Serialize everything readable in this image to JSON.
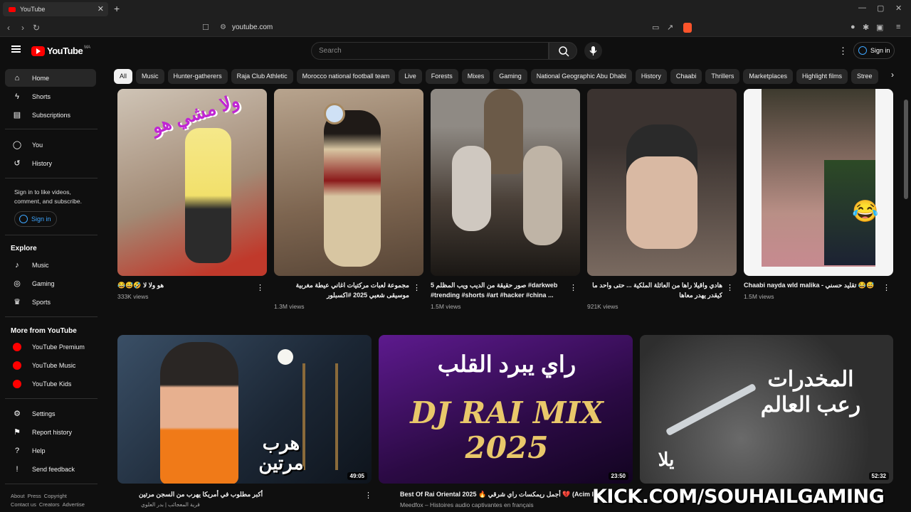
{
  "browser": {
    "tab_title": "YouTube",
    "url": "youtube.com"
  },
  "header": {
    "logo_text": "YouTube",
    "region": "MA",
    "search_placeholder": "Search",
    "signin_label": "Sign in"
  },
  "sidebar": {
    "main": [
      {
        "label": "Home",
        "icon": "home-icon",
        "active": true
      },
      {
        "label": "Shorts",
        "icon": "shorts-icon"
      },
      {
        "label": "Subscriptions",
        "icon": "subscriptions-icon"
      }
    ],
    "you": [
      {
        "label": "You",
        "icon": "user-icon"
      },
      {
        "label": "History",
        "icon": "history-icon"
      }
    ],
    "signin_note": "Sign in to like videos, comment, and subscribe.",
    "signin_label": "Sign in",
    "explore_heading": "Explore",
    "explore": [
      {
        "label": "Music",
        "icon": "music-icon"
      },
      {
        "label": "Gaming",
        "icon": "gaming-icon"
      },
      {
        "label": "Sports",
        "icon": "trophy-icon"
      }
    ],
    "more_heading": "More from YouTube",
    "more": [
      {
        "label": "YouTube Premium",
        "icon": "youtube-premium-icon"
      },
      {
        "label": "YouTube Music",
        "icon": "youtube-music-icon"
      },
      {
        "label": "YouTube Kids",
        "icon": "youtube-kids-icon"
      }
    ],
    "settings": [
      {
        "label": "Settings",
        "icon": "gear-icon"
      },
      {
        "label": "Report history",
        "icon": "flag-icon"
      },
      {
        "label": "Help",
        "icon": "help-icon"
      },
      {
        "label": "Send feedback",
        "icon": "feedback-icon"
      }
    ],
    "footer_row1": [
      "About",
      "Press",
      "Copyright"
    ],
    "footer_row2": [
      "Contact us",
      "Creators",
      "Advertise"
    ]
  },
  "chips": [
    "All",
    "Music",
    "Hunter-gatherers",
    "Raja Club Athletic",
    "Morocco national football team",
    "Live",
    "Forests",
    "Mixes",
    "Gaming",
    "National Geographic Abu Dhabi",
    "History",
    "Chaabi",
    "Thrillers",
    "Marketplaces",
    "Highlight films",
    "Stree"
  ],
  "shorts": [
    {
      "title": "😂😅🤣 هو ولا لا",
      "views": "333K views",
      "thumb_text": "ولا مشي هو",
      "bg": "#b8a58f"
    },
    {
      "title": "مجموعة لعبات مركتيات اغاني عيطة مغربية موسيقى شعبي 2025 #اكسبلور",
      "views": "1.3M views",
      "bg": "#8a7663"
    },
    {
      "title": "5 صور حقيقة من الديب ويب المظلم #darkweb #trending #shorts #art #hacker #china ...",
      "views": "1.5M views",
      "bg": "#5a534a"
    },
    {
      "title": "هادي واقيلا راها من العائلة الملكية ... حتى واحد ما كيقدر يهدر معاها",
      "views": "921K views",
      "bg": "#6e6158"
    },
    {
      "title": "Chaabi nayda wld malika - تقليد حسني 😂😅",
      "views": "1.5M views",
      "bg": "#6a5a4c"
    }
  ],
  "videos": [
    {
      "title": "أكبر مطلوب في أمريكا يهرب من السجن مرتين",
      "channel": "قرية المعجائب | بدر العلوي",
      "duration": "49:05",
      "thumb_text": "هرب مرتين",
      "bg": "#243546"
    },
    {
      "title": "Best Of Rai Oriental 2025 🔥 أجمل ريمكسات راي شرقي 💔 (Acim R",
      "channel": "Meedfox – Histoires audio captivantes en français",
      "duration": "23:50",
      "thumb_text": "DJ RAI MIX 2025",
      "thumb_top": "راي يبرد القلب",
      "bg": "#3a1258"
    },
    {
      "title": "",
      "channel": "",
      "duration": "52:32",
      "thumb_text": "المخدرات رعب العالم",
      "thumb_sub": "يلا",
      "bg": "#4a4a4a"
    }
  ],
  "watermark": "KICK.COM/SOUHAILGAMING"
}
